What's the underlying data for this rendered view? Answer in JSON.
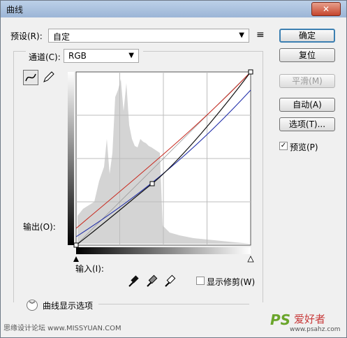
{
  "window": {
    "title": "曲线",
    "close_glyph": "✕"
  },
  "preset": {
    "label": "预设(R):",
    "value": "自定",
    "menu_glyph": "≡"
  },
  "channel": {
    "label": "通道(C):",
    "value": "RGB"
  },
  "buttons": {
    "ok": "确定",
    "reset": "复位",
    "smooth": "平滑(M)",
    "auto": "自动(A)",
    "options": "选项(T)...",
    "preview": "预览(P)"
  },
  "preview_checked": true,
  "graph": {
    "output_label": "输出(O):",
    "input_label": "输入(I):"
  },
  "clipping": {
    "label": "显示修剪(W)",
    "checked": false
  },
  "display_options": {
    "label": "曲线显示选项"
  },
  "watermarks": {
    "left": "思缘设计论坛 www.MISSYUAN.COM",
    "ps_logo": "PS",
    "brand": "爱好者",
    "url": "www.psahz.com"
  },
  "colors": {
    "curve_red": "#c8281e",
    "curve_blue": "#1c2aa8",
    "curve_black": "#111111",
    "histogram": "#d4d4d4",
    "accent": "#3c7fb1"
  }
}
